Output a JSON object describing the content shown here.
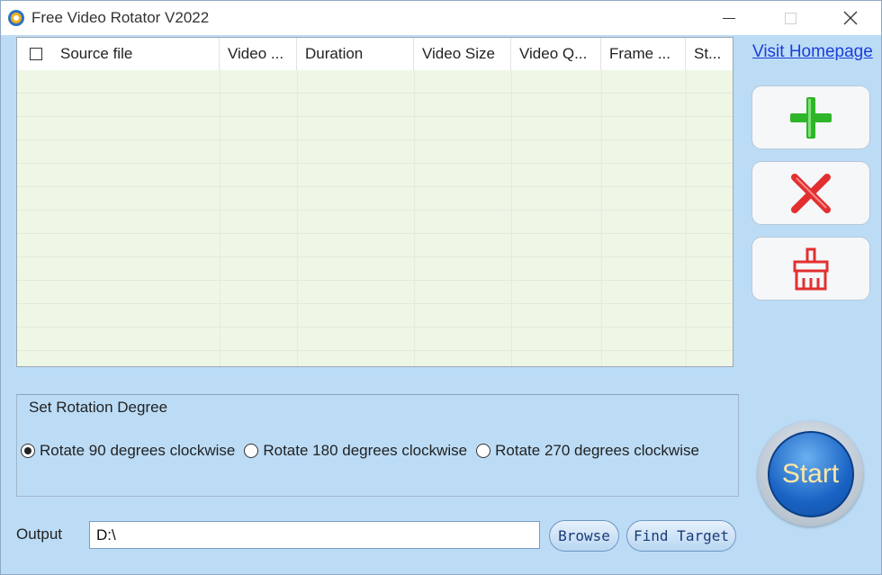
{
  "window": {
    "title": "Free Video Rotator V2022",
    "icons": {
      "app": "app-logo-icon",
      "minimize": "minimize-icon",
      "maximize": "maximize-icon",
      "close": "close-icon"
    }
  },
  "file_list": {
    "select_all_icon": "checkbox-icon",
    "columns": [
      "Source file",
      "Video ...",
      "Duration",
      "Video Size",
      "Video Q...",
      "Frame ...",
      "St..."
    ]
  },
  "side_panel": {
    "homepage_link": "Visit Homepage",
    "add_icon": "plus-icon",
    "remove_icon": "x-icon",
    "clear_icon": "broom-icon",
    "colors": {
      "add": "#2fb52a",
      "remove": "#e23030",
      "clear": "#e23030"
    }
  },
  "rotation": {
    "group_title": "Set Rotation Degree",
    "options": [
      {
        "label": "Rotate 90 degrees clockwise",
        "selected": true
      },
      {
        "label": "Rotate 180 degrees clockwise",
        "selected": false
      },
      {
        "label": "Rotate 270 degrees clockwise",
        "selected": false
      }
    ]
  },
  "start_button": {
    "label": "Start"
  },
  "output": {
    "label": "Output",
    "path": "D:\\",
    "browse_label": "Browse",
    "find_target_label": "Find Target"
  },
  "colors": {
    "window_bg": "#bcdcf6",
    "list_bg": "#eef6e6",
    "link": "#1a3fd8"
  }
}
